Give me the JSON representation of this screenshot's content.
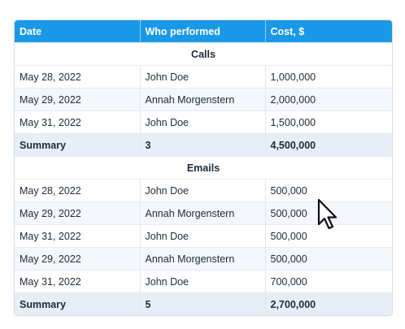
{
  "table": {
    "headers": [
      "Date",
      "Who performed",
      "Cost, $"
    ],
    "sections": [
      {
        "title": "Calls",
        "rows": [
          [
            "May 28, 2022",
            "John Doe",
            "1,000,000"
          ],
          [
            "May 29, 2022",
            "Annah Morgenstern",
            "2,000,000"
          ],
          [
            "May 31, 2022",
            "John Doe",
            "1,500,000"
          ]
        ],
        "summary": [
          "Summary",
          "3",
          "4,500,000"
        ]
      },
      {
        "title": "Emails",
        "rows": [
          [
            "May 28, 2022",
            "John Doe",
            "500,000"
          ],
          [
            "May 29, 2022",
            "Annah Morgenstern",
            "500,000"
          ],
          [
            "May 31, 2022",
            "John Doe",
            "500,000"
          ],
          [
            "May 29, 2022",
            "Annah Morgenstern",
            "500,000"
          ],
          [
            "May 31, 2022",
            "John Doe",
            "700,000"
          ]
        ],
        "summary": [
          "Summary",
          "5",
          "2,700,000"
        ]
      }
    ]
  },
  "colors": {
    "header_bg": "#1a98e8",
    "header_text": "#ffffff",
    "summary_bg": "#e8eef7",
    "alt_row_bg": "#f4f7fb"
  },
  "icons": {
    "cursor": "mouse-pointer-icon"
  }
}
